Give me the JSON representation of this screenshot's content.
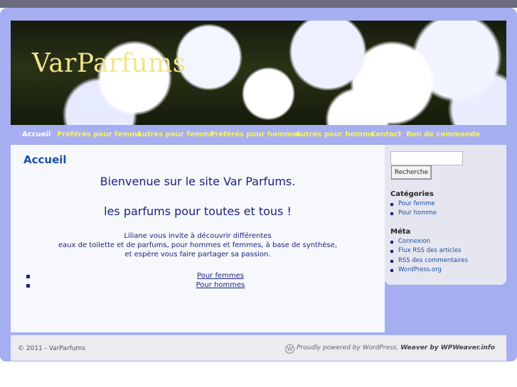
{
  "site": {
    "logo": "VarParfums"
  },
  "nav": {
    "items": [
      {
        "label": "Accueil"
      },
      {
        "label": "Préférés pour femme"
      },
      {
        "label": "Autres pour femme"
      },
      {
        "label": "Préférés pour hommes"
      },
      {
        "label": "Autres pour homme"
      },
      {
        "label": "Contact"
      },
      {
        "label": "Bon de commande"
      }
    ]
  },
  "main": {
    "title": "Accueil",
    "welcome_line1": "Bienvenue sur le site Var Parfums.",
    "welcome_line2": "les parfums pour toutes et tous !",
    "invite_lines": [
      "Liliane vous invite à découvrir différentes",
      "eaux de toilette et de parfums, pour hommes et femmes, à base de synthèse,",
      "et espère vous faire partager sa passion."
    ],
    "links": [
      {
        "label": "Pour femmes"
      },
      {
        "label": "Pour hommes"
      }
    ]
  },
  "sidebar": {
    "search": {
      "value": "",
      "button_label": "Recherche"
    },
    "categories": {
      "title": "Catégories",
      "items": [
        {
          "label": "Pour femme"
        },
        {
          "label": "Pour homme"
        }
      ]
    },
    "meta": {
      "title": "Méta",
      "items": [
        {
          "label": "Connexion"
        },
        {
          "label": "Flux RSS des articles"
        },
        {
          "label": "RSS des commentaires"
        },
        {
          "label": "WordPress.org"
        }
      ]
    }
  },
  "footer": {
    "copyright": "© 2011 - VarParfums",
    "powered": "Proudly powered by WordPress.",
    "weaver": "Weaver by WPWeaver.info"
  },
  "colors": {
    "nav_link": "#fff34a",
    "accent_blue": "#1c4fa3",
    "frame": "#a6aef2"
  }
}
